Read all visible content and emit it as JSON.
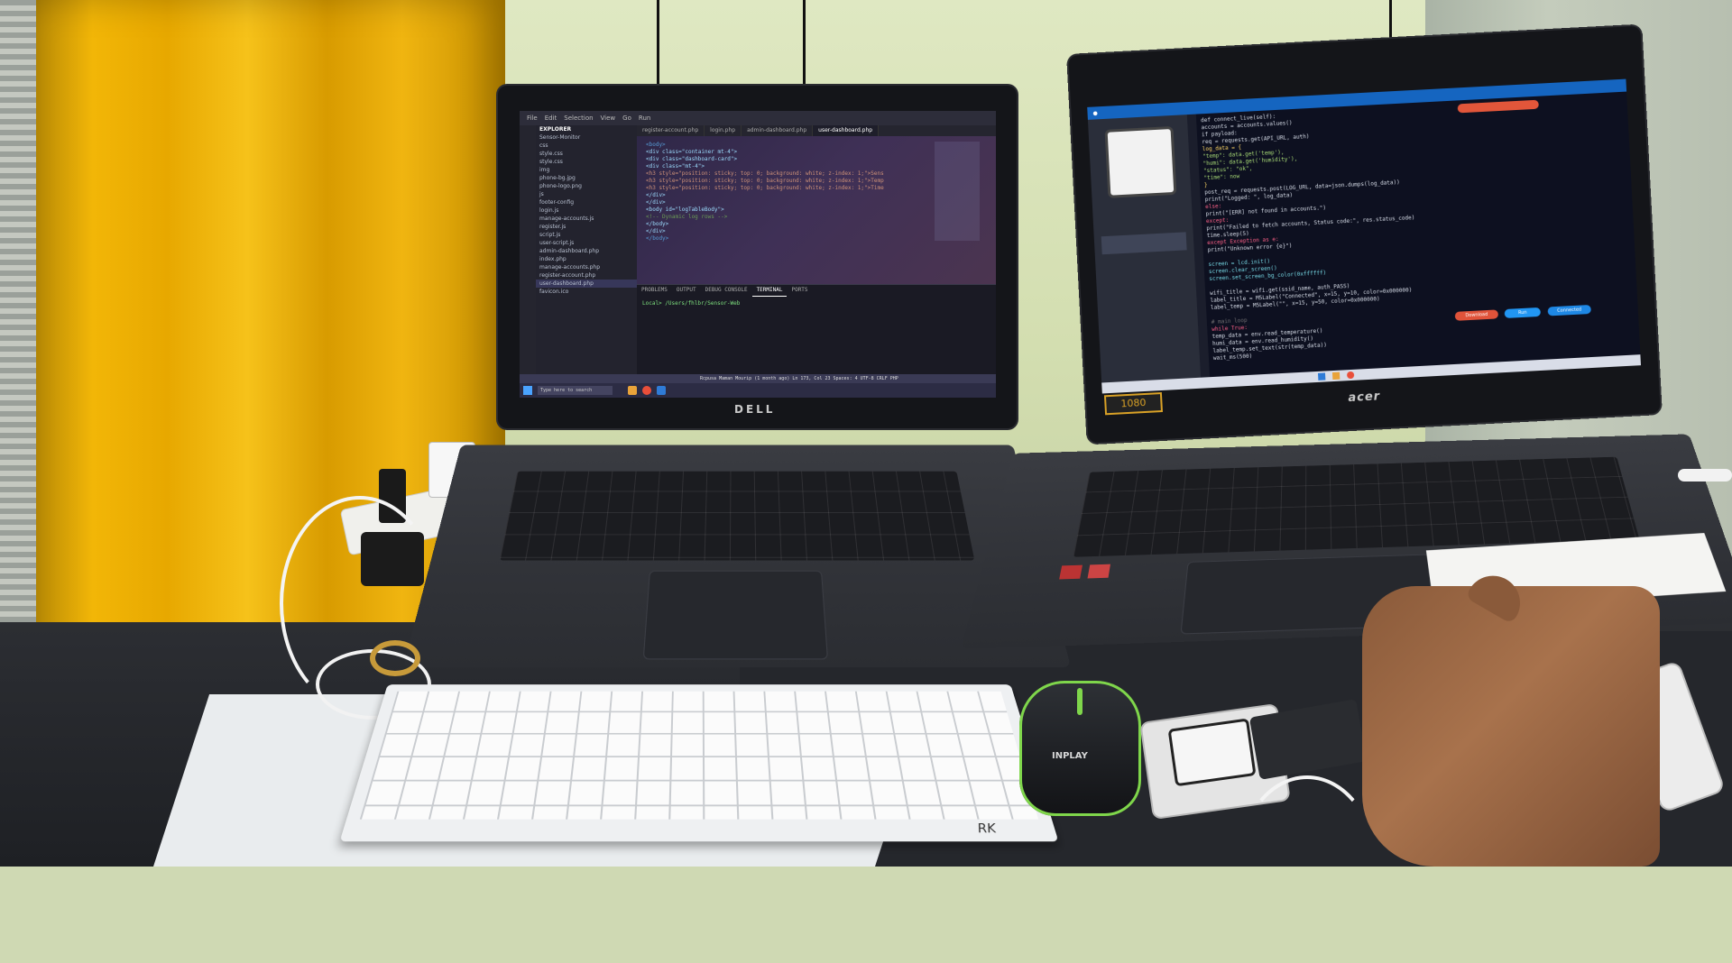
{
  "scene": {
    "description_items": [
      "curtain",
      "dell-laptop",
      "acer-laptop",
      "mechanical-keyboard",
      "gaming-mouse",
      "handheld-device",
      "hand"
    ]
  },
  "laptop_left": {
    "brand": "DELL",
    "editor": {
      "sidebar_title": "EXPLORER",
      "tabs": [
        "register-account.php",
        "login.php",
        "admin-dashboard.php",
        "user-dashboard.php"
      ],
      "files": [
        "Sensor-Monitor",
        "css",
        "style.css",
        "style.css",
        "img",
        "phone-bg.jpg",
        "phone-logo.png",
        "js",
        "footer-config",
        "login.js",
        "manage-accounts.js",
        "register.js",
        "script.js",
        "user-script.js",
        "admin-dashboard.php",
        "index.php",
        "manage-accounts.php",
        "register-account.php",
        "user-dashboard.php",
        "favicon.ico"
      ],
      "code_lines": [
        "<body>",
        "  <div class=\"container mt-4\">",
        "    <div class=\"dashboard-card\">",
        "      <div class=\"mt-4\">",
        "        <h3 style=\"position: sticky; top: 0; background: white; z-index: 1;\">Sens",
        "        <h3 style=\"position: sticky; top: 0; background: white; z-index: 1;\">Temp",
        "        <h3 style=\"position: sticky; top: 0; background: white; z-index: 1;\">Time",
        "      </div>",
        "    </div>",
        "    <body id=\"logTableBody\">",
        "      <!-- Dynamic log rows -->",
        "    </body>",
        "  </div>",
        "</body>"
      ],
      "terminal_tabs": [
        "PROBLEMS",
        "OUTPUT",
        "DEBUG CONSOLE",
        "TERMINAL",
        "PORTS"
      ],
      "terminal_line": "Local> /Users/fhlbr/Sensor-Web",
      "status": "Rcpusa Maman Mourip (1 month ago)    Ln 173, Col 23    Spaces: 4    UTF-8    CRLF    PHP"
    },
    "taskbar": {
      "search_placeholder": "Type here to search"
    }
  },
  "laptop_right": {
    "brand": "acer",
    "sticker": "1080",
    "ide": {
      "code_lines": [
        "      def connect_live(self):",
        "          accounts = accounts.values()",
        "          if payload: ",
        "              req = requests.get(API_URL, auth)",
        "              log_data = {",
        "                  \"temp\": data.get('temp'),",
        "                  \"humi\": data.get('humidity'),",
        "                  \"status\": \"ok\",",
        "                  \"time\": now",
        "              }",
        "              post_req = requests.post(LOG_URL, data=json.dumps(log_data))",
        "              print(\"Logged: \", log_data)",
        "          else:",
        "              print(\"[ERR] not found in accounts.\")",
        "      except:",
        "          print(\"Failed to fetch accounts, Status code:\", res.status_code)",
        "      time.sleep(5)",
        "  except Exception as e:",
        "      print(\"Unknown error {e}\")",
        "",
        "  screen = lcd.init()",
        "  screen.clear_screen()",
        "  screen.set_screen_bg_color(0xffffff)",
        "",
        "  wifi_title = wifi.get(ssid_name, auth_PASS)",
        "  label_title = M5Label(\"Connected\", x=15, y=10, color=0x000000)",
        "  label_temp = M5Label(\"\", x=15, y=50, color=0x000000)",
        "",
        "  # main loop",
        "  while True:",
        "      temp_data = env.read_temperature()",
        "      humi_data = env.read_humidity()",
        "      label_temp.set_text(str(temp_data))",
        "      wait_ms(500)"
      ],
      "buttons": [
        "Download",
        "Run",
        "Connected"
      ]
    }
  },
  "peripherals": {
    "keyboard_brand": "RK",
    "mouse_brand": "INPLAY"
  },
  "colors": {
    "curtain": "#f2b607",
    "wall": "#dfe8c2",
    "desk_mat": "#25272c",
    "mouse_accent": "#7fd64b",
    "ide_topbar": "#1565c0"
  }
}
